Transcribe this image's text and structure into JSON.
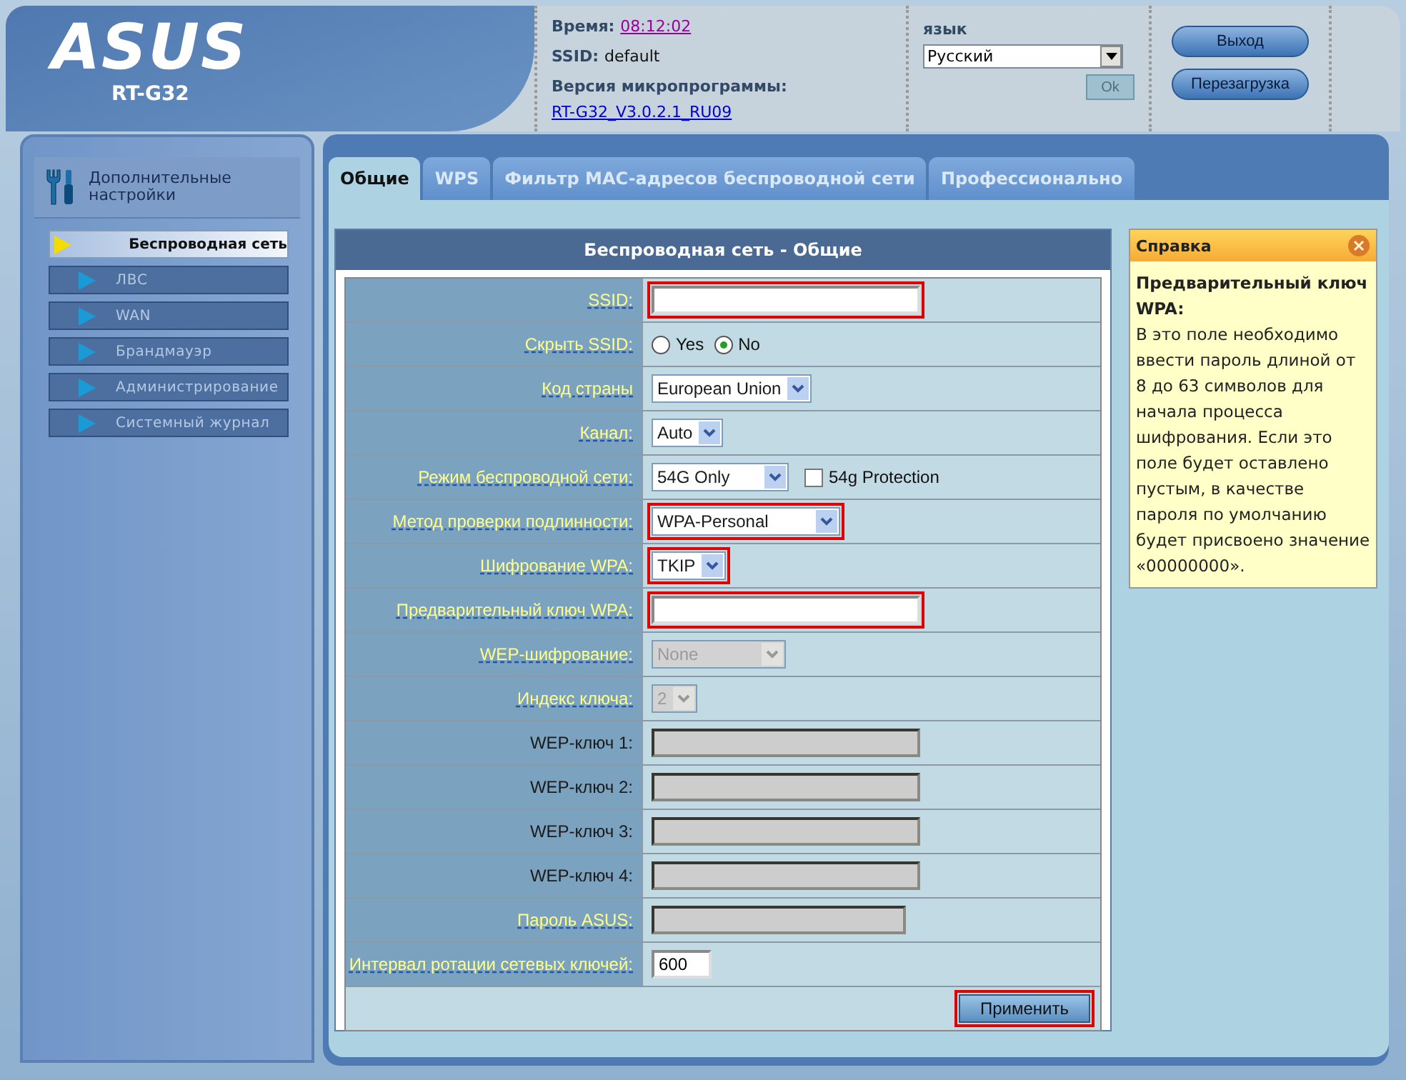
{
  "header": {
    "logo": "ASUS",
    "model": "RT-G32",
    "time_label": "Время:",
    "time": "08:12:02",
    "ssid_label": "SSID:",
    "ssid": "default",
    "firmware_label": "Версия микропрограммы:",
    "firmware": "RT-G32_V3.0.2.1_RU09",
    "language_label": "язык",
    "language": "Русский",
    "ok_button": {
      "label": "Ok",
      "disabled": true
    },
    "buttons": [
      "Выход",
      "Перезагрузка"
    ]
  },
  "sidebar": {
    "title": "Дополнительные настройки",
    "items": [
      {
        "label": "Беспроводная сеть",
        "selected": true
      },
      {
        "label": "ЛВС",
        "selected": false
      },
      {
        "label": "WAN",
        "selected": false
      },
      {
        "label": "Брандмауэр",
        "selected": false
      },
      {
        "label": "Администрирование",
        "selected": false
      },
      {
        "label": "Системный журнал",
        "selected": false
      }
    ]
  },
  "tabs": [
    {
      "label": "Общие",
      "selected": true
    },
    {
      "label": "WPS",
      "selected": false
    },
    {
      "label": "Фильтр MAC-адресов беспроводной сети",
      "selected": false
    },
    {
      "label": "Профессионально",
      "selected": false
    }
  ],
  "form": {
    "title": "Беспроводная сеть - Общие",
    "rows": [
      {
        "label": "SSID:",
        "help": true,
        "highlighted": true,
        "kind": "text",
        "disabled": false
      },
      {
        "label": "Скрыть SSID:",
        "help": true,
        "kind": "radio",
        "options": [
          {
            "label": "Yes",
            "selected": false
          },
          {
            "label": "No",
            "selected": true
          }
        ]
      },
      {
        "label": "Код страны",
        "help": true,
        "highlighted": false,
        "kind": "select",
        "value": "European Union",
        "disabled": false
      },
      {
        "label": "Канал:",
        "help": true,
        "highlighted": false,
        "kind": "select",
        "value": "Auto",
        "disabled": false
      },
      {
        "label": "Режим беспроводной сети:",
        "help": true,
        "highlighted": false,
        "kind": "select",
        "value": "54G Only",
        "disabled": false,
        "checkbox": {
          "label": "54g Protection",
          "checked": false
        }
      },
      {
        "label": "Метод проверки подлинности:",
        "help": true,
        "highlighted": true,
        "kind": "select",
        "value": "WPA-Personal",
        "disabled": false
      },
      {
        "label": "Шифрование WPA:",
        "help": true,
        "highlighted": true,
        "kind": "select",
        "value": "TKIP",
        "disabled": false
      },
      {
        "label": "Предварительный ключ WPA:",
        "help": true,
        "highlighted": true,
        "kind": "text",
        "disabled": false
      },
      {
        "label": "WEP-шифрование:",
        "help": true,
        "highlighted": false,
        "kind": "select",
        "value": "None",
        "disabled": true
      },
      {
        "label": "Индекс ключа:",
        "help": true,
        "highlighted": false,
        "kind": "select",
        "value": "2",
        "disabled": true
      },
      {
        "label": "WEP-ключ 1:",
        "help": false,
        "highlighted": false,
        "kind": "text",
        "disabled": true
      },
      {
        "label": "WEP-ключ 2:",
        "help": false,
        "highlighted": false,
        "kind": "text",
        "disabled": true
      },
      {
        "label": "WEP-ключ 3:",
        "help": false,
        "highlighted": false,
        "kind": "text",
        "disabled": true
      },
      {
        "label": "WEP-ключ 4:",
        "help": false,
        "highlighted": false,
        "kind": "text",
        "disabled": true
      },
      {
        "label": "Пароль ASUS:",
        "help": true,
        "highlighted": false,
        "kind": "text",
        "disabled": true
      },
      {
        "label": "Интервал ротации сетевых ключей:",
        "help": true,
        "highlighted": false,
        "kind": "text",
        "value": "600",
        "disabled": false
      }
    ],
    "apply_button": {
      "label": "Применить",
      "highlighted": true
    }
  },
  "help_panel": {
    "title": "Справка",
    "heading": "Предварительный ключ WPA:",
    "text": "В это поле необходимо ввести пароль длиной от 8 до 63 символов для начала процесса шифрования. Если это поле будет оставлено пустым, в качестве пароля по умолчанию будет присвоено значение «00000000»."
  }
}
